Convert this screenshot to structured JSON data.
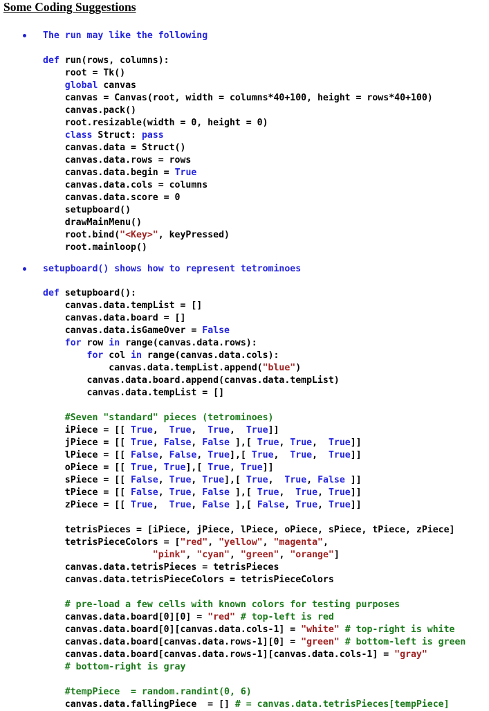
{
  "document": {
    "title": "Some Coding Suggestions"
  },
  "colors": {
    "keyword": "#2424e0",
    "boolean": "#2424e0",
    "string": "#a02020",
    "comment": "#1a7a1a",
    "identifier": "#000000",
    "bullet": "#2222cc",
    "background": "#ffffff"
  },
  "sections": [
    {
      "bullet": "The run may like the following",
      "code": [
        [
          {
            "t": "def",
            "c": "kw"
          },
          {
            "t": " run(rows, columns):",
            "c": "plain"
          }
        ],
        [
          {
            "t": "    root = Tk()",
            "c": "plain"
          }
        ],
        [
          {
            "t": "    ",
            "c": "plain"
          },
          {
            "t": "global",
            "c": "kw"
          },
          {
            "t": " canvas",
            "c": "plain"
          }
        ],
        [
          {
            "t": "    canvas = Canvas(root, width = columns*40+100, height = rows*40+100)",
            "c": "plain"
          }
        ],
        [
          {
            "t": "    canvas.pack()",
            "c": "plain"
          }
        ],
        [
          {
            "t": "    root.resizable(width = 0, height = 0)",
            "c": "plain"
          }
        ],
        [
          {
            "t": "    ",
            "c": "plain"
          },
          {
            "t": "class",
            "c": "kw"
          },
          {
            "t": " Struct: ",
            "c": "plain"
          },
          {
            "t": "pass",
            "c": "kw"
          }
        ],
        [
          {
            "t": "    canvas.data = Struct()",
            "c": "plain"
          }
        ],
        [
          {
            "t": "    canvas.data.rows = rows",
            "c": "plain"
          }
        ],
        [
          {
            "t": "    canvas.data.begin = ",
            "c": "plain"
          },
          {
            "t": "True",
            "c": "bool"
          }
        ],
        [
          {
            "t": "    canvas.data.cols = columns",
            "c": "plain"
          }
        ],
        [
          {
            "t": "    canvas.data.score = 0",
            "c": "plain"
          }
        ],
        [
          {
            "t": "    setupboard()",
            "c": "plain"
          }
        ],
        [
          {
            "t": "    drawMainMenu()",
            "c": "plain"
          }
        ],
        [
          {
            "t": "    root.bind(",
            "c": "plain"
          },
          {
            "t": "\"<Key>\"",
            "c": "str"
          },
          {
            "t": ", keyPressed)",
            "c": "plain"
          }
        ],
        [
          {
            "t": "    root.mainloop()",
            "c": "plain"
          }
        ]
      ]
    },
    {
      "bullet": "setupboard() shows how to represent tetrominoes",
      "code": [
        [
          {
            "t": "def",
            "c": "kw"
          },
          {
            "t": " setupboard():",
            "c": "plain"
          }
        ],
        [
          {
            "t": "    canvas.data.tempList = []",
            "c": "plain"
          }
        ],
        [
          {
            "t": "    canvas.data.board = []",
            "c": "plain"
          }
        ],
        [
          {
            "t": "    canvas.data.isGameOver = ",
            "c": "plain"
          },
          {
            "t": "False",
            "c": "bool"
          }
        ],
        [
          {
            "t": "    ",
            "c": "plain"
          },
          {
            "t": "for",
            "c": "kw"
          },
          {
            "t": " row ",
            "c": "plain"
          },
          {
            "t": "in",
            "c": "kw"
          },
          {
            "t": " range(canvas.data.rows):",
            "c": "plain"
          }
        ],
        [
          {
            "t": "        ",
            "c": "plain"
          },
          {
            "t": "for",
            "c": "kw"
          },
          {
            "t": " col ",
            "c": "plain"
          },
          {
            "t": "in",
            "c": "kw"
          },
          {
            "t": " range(canvas.data.cols):",
            "c": "plain"
          }
        ],
        [
          {
            "t": "            canvas.data.tempList.append(",
            "c": "plain"
          },
          {
            "t": "\"blue\"",
            "c": "str"
          },
          {
            "t": ")",
            "c": "plain"
          }
        ],
        [
          {
            "t": "        canvas.data.board.append(canvas.data.tempList)",
            "c": "plain"
          }
        ],
        [
          {
            "t": "        canvas.data.tempList = []",
            "c": "plain"
          }
        ],
        [
          {
            "t": "",
            "c": "plain"
          }
        ],
        [
          {
            "t": "    ",
            "c": "plain"
          },
          {
            "t": "#Seven \"standard\" pieces (tetrominoes)",
            "c": "cmt"
          }
        ],
        [
          {
            "t": "    iPiece = [[ ",
            "c": "plain"
          },
          {
            "t": "True",
            "c": "bool"
          },
          {
            "t": ",  ",
            "c": "plain"
          },
          {
            "t": "True",
            "c": "bool"
          },
          {
            "t": ",  ",
            "c": "plain"
          },
          {
            "t": "True",
            "c": "bool"
          },
          {
            "t": ",  ",
            "c": "plain"
          },
          {
            "t": "True",
            "c": "bool"
          },
          {
            "t": "]]",
            "c": "plain"
          }
        ],
        [
          {
            "t": "    jPiece = [[ ",
            "c": "plain"
          },
          {
            "t": "True",
            "c": "bool"
          },
          {
            "t": ", ",
            "c": "plain"
          },
          {
            "t": "False",
            "c": "bool"
          },
          {
            "t": ", ",
            "c": "plain"
          },
          {
            "t": "False",
            "c": "bool"
          },
          {
            "t": " ],[ ",
            "c": "plain"
          },
          {
            "t": "True",
            "c": "bool"
          },
          {
            "t": ", ",
            "c": "plain"
          },
          {
            "t": "True",
            "c": "bool"
          },
          {
            "t": ",  ",
            "c": "plain"
          },
          {
            "t": "True",
            "c": "bool"
          },
          {
            "t": "]]",
            "c": "plain"
          }
        ],
        [
          {
            "t": "    lPiece = [[ ",
            "c": "plain"
          },
          {
            "t": "False",
            "c": "bool"
          },
          {
            "t": ", ",
            "c": "plain"
          },
          {
            "t": "False",
            "c": "bool"
          },
          {
            "t": ", ",
            "c": "plain"
          },
          {
            "t": "True",
            "c": "bool"
          },
          {
            "t": "],[ ",
            "c": "plain"
          },
          {
            "t": "True",
            "c": "bool"
          },
          {
            "t": ",  ",
            "c": "plain"
          },
          {
            "t": "True",
            "c": "bool"
          },
          {
            "t": ",  ",
            "c": "plain"
          },
          {
            "t": "True",
            "c": "bool"
          },
          {
            "t": "]]",
            "c": "plain"
          }
        ],
        [
          {
            "t": "    oPiece = [[ ",
            "c": "plain"
          },
          {
            "t": "True",
            "c": "bool"
          },
          {
            "t": ", ",
            "c": "plain"
          },
          {
            "t": "True",
            "c": "bool"
          },
          {
            "t": "],[ ",
            "c": "plain"
          },
          {
            "t": "True",
            "c": "bool"
          },
          {
            "t": ", ",
            "c": "plain"
          },
          {
            "t": "True",
            "c": "bool"
          },
          {
            "t": "]]",
            "c": "plain"
          }
        ],
        [
          {
            "t": "    sPiece = [[ ",
            "c": "plain"
          },
          {
            "t": "False",
            "c": "bool"
          },
          {
            "t": ", ",
            "c": "plain"
          },
          {
            "t": "True",
            "c": "bool"
          },
          {
            "t": ", ",
            "c": "plain"
          },
          {
            "t": "True",
            "c": "bool"
          },
          {
            "t": "],[ ",
            "c": "plain"
          },
          {
            "t": "True",
            "c": "bool"
          },
          {
            "t": ",  ",
            "c": "plain"
          },
          {
            "t": "True",
            "c": "bool"
          },
          {
            "t": ", ",
            "c": "plain"
          },
          {
            "t": "False",
            "c": "bool"
          },
          {
            "t": " ]]",
            "c": "plain"
          }
        ],
        [
          {
            "t": "    tPiece = [[ ",
            "c": "plain"
          },
          {
            "t": "False",
            "c": "bool"
          },
          {
            "t": ", ",
            "c": "plain"
          },
          {
            "t": "True",
            "c": "bool"
          },
          {
            "t": ", ",
            "c": "plain"
          },
          {
            "t": "False",
            "c": "bool"
          },
          {
            "t": " ],[ ",
            "c": "plain"
          },
          {
            "t": "True",
            "c": "bool"
          },
          {
            "t": ",  ",
            "c": "plain"
          },
          {
            "t": "True",
            "c": "bool"
          },
          {
            "t": ", ",
            "c": "plain"
          },
          {
            "t": "True",
            "c": "bool"
          },
          {
            "t": "]]",
            "c": "plain"
          }
        ],
        [
          {
            "t": "    zPiece = [[ ",
            "c": "plain"
          },
          {
            "t": "True",
            "c": "bool"
          },
          {
            "t": ",  ",
            "c": "plain"
          },
          {
            "t": "True",
            "c": "bool"
          },
          {
            "t": ", ",
            "c": "plain"
          },
          {
            "t": "False",
            "c": "bool"
          },
          {
            "t": " ],[ ",
            "c": "plain"
          },
          {
            "t": "False",
            "c": "bool"
          },
          {
            "t": ", ",
            "c": "plain"
          },
          {
            "t": "True",
            "c": "bool"
          },
          {
            "t": ", ",
            "c": "plain"
          },
          {
            "t": "True",
            "c": "bool"
          },
          {
            "t": "]]",
            "c": "plain"
          }
        ],
        [
          {
            "t": "",
            "c": "plain"
          }
        ],
        [
          {
            "t": "    tetrisPieces = [iPiece, jPiece, lPiece, oPiece, sPiece, tPiece, zPiece]",
            "c": "plain"
          }
        ],
        [
          {
            "t": "    tetrisPieceColors = [",
            "c": "plain"
          },
          {
            "t": "\"red\"",
            "c": "str"
          },
          {
            "t": ", ",
            "c": "plain"
          },
          {
            "t": "\"yellow\"",
            "c": "str"
          },
          {
            "t": ", ",
            "c": "plain"
          },
          {
            "t": "\"magenta\"",
            "c": "str"
          },
          {
            "t": ",",
            "c": "plain"
          }
        ],
        [
          {
            "t": "                    ",
            "c": "plain"
          },
          {
            "t": "\"pink\"",
            "c": "str"
          },
          {
            "t": ", ",
            "c": "plain"
          },
          {
            "t": "\"cyan\"",
            "c": "str"
          },
          {
            "t": ", ",
            "c": "plain"
          },
          {
            "t": "\"green\"",
            "c": "str"
          },
          {
            "t": ", ",
            "c": "plain"
          },
          {
            "t": "\"orange\"",
            "c": "str"
          },
          {
            "t": "]",
            "c": "plain"
          }
        ],
        [
          {
            "t": "    canvas.data.tetrisPieces = tetrisPieces",
            "c": "plain"
          }
        ],
        [
          {
            "t": "    canvas.data.tetrisPieceColors = tetrisPieceColors",
            "c": "plain"
          }
        ],
        [
          {
            "t": "",
            "c": "plain"
          }
        ],
        [
          {
            "t": "    ",
            "c": "plain"
          },
          {
            "t": "# pre-load a few cells with known colors for testing purposes",
            "c": "cmt"
          }
        ],
        [
          {
            "t": "    canvas.data.board[0][0] = ",
            "c": "plain"
          },
          {
            "t": "\"red\"",
            "c": "str"
          },
          {
            "t": " ",
            "c": "plain"
          },
          {
            "t": "# top-left is red",
            "c": "cmt"
          }
        ],
        [
          {
            "t": "    canvas.data.board[0][canvas.data.cols-1] = ",
            "c": "plain"
          },
          {
            "t": "\"white\"",
            "c": "str"
          },
          {
            "t": " ",
            "c": "plain"
          },
          {
            "t": "# top-right is white",
            "c": "cmt"
          }
        ],
        [
          {
            "t": "    canvas.data.board[canvas.data.rows-1][0] = ",
            "c": "plain"
          },
          {
            "t": "\"green\"",
            "c": "str"
          },
          {
            "t": " ",
            "c": "plain"
          },
          {
            "t": "# bottom-left is green",
            "c": "cmt"
          }
        ],
        [
          {
            "t": "    canvas.data.board[canvas.data.rows-1][canvas.data.cols-1] = ",
            "c": "plain"
          },
          {
            "t": "\"gray\"",
            "c": "str"
          }
        ],
        [
          {
            "t": "    ",
            "c": "plain"
          },
          {
            "t": "# bottom-right is gray",
            "c": "cmt"
          }
        ],
        [
          {
            "t": "",
            "c": "plain"
          }
        ],
        [
          {
            "t": "    ",
            "c": "plain"
          },
          {
            "t": "#tempPiece  = random.randint(0, 6)",
            "c": "cmt"
          }
        ],
        [
          {
            "t": "    canvas.data.fallingPiece  = [] ",
            "c": "plain"
          },
          {
            "t": "# = canvas.data.tetrisPieces[tempPiece]",
            "c": "cmt"
          }
        ]
      ]
    }
  ],
  "layout": {
    "section_tops": [
      43,
      380
    ],
    "code_tops": [
      79,
      415
    ]
  }
}
